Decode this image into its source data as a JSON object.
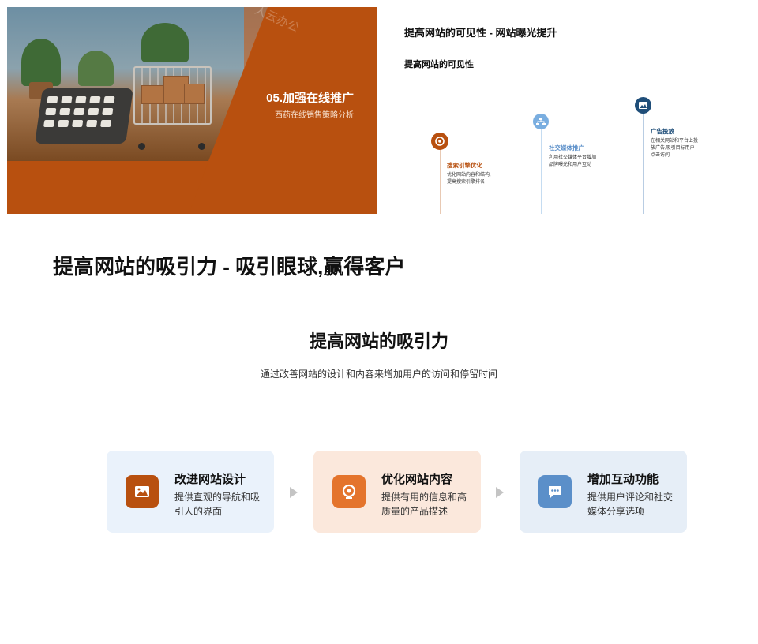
{
  "slide1": {
    "title": "05.加强在线推广",
    "subtitle": "西药在线销售策略分析",
    "watermark": "人云办公",
    "colors": {
      "background": "#b8500f",
      "text": "#ffffff"
    }
  },
  "slide2": {
    "title": "提高网站的可见性 - 网站曝光提升",
    "subtitle": "提高网站的可见性",
    "timeline": [
      {
        "icon": "target-icon",
        "heading": "搜索引擎优化",
        "desc_line1": "优化网站内容和结构,",
        "desc_line2": "提高搜索引擎排名",
        "color": "#b8500f"
      },
      {
        "icon": "network-icon",
        "heading": "社交媒体推广",
        "desc_line1": "利用社交媒体平台增加",
        "desc_line2": "品牌曝光和用户互动",
        "color": "#7aaee0"
      },
      {
        "icon": "image-icon",
        "heading": "广告投放",
        "desc_line1": "在相关网站和平台上投",
        "desc_line2": "放广告,吸引目标用户",
        "desc_line3": "点击访问",
        "color": "#1f4e79"
      }
    ]
  },
  "slide3": {
    "heading": "提高网站的吸引力 - 吸引眼球,赢得客户",
    "center_title": "提高网站的吸引力",
    "center_subtitle": "通过改善网站的设计和内容来增加用户的访问和停留时间",
    "cards": [
      {
        "icon": "image-icon",
        "title": "改进网站设计",
        "desc": "提供直观的导航和吸引人的界面",
        "bg": "#eaf2fb",
        "icon_bg": "#b8500f"
      },
      {
        "icon": "target-icon",
        "title": "优化网站内容",
        "desc": "提供有用的信息和高质量的产品描述",
        "bg": "#fbe8dc",
        "icon_bg": "#e4742c"
      },
      {
        "icon": "chat-icon",
        "title": "增加互动功能",
        "desc": "提供用户评论和社交媒体分享选项",
        "bg": "#e6eef7",
        "icon_bg": "#5b8fc9"
      }
    ]
  }
}
